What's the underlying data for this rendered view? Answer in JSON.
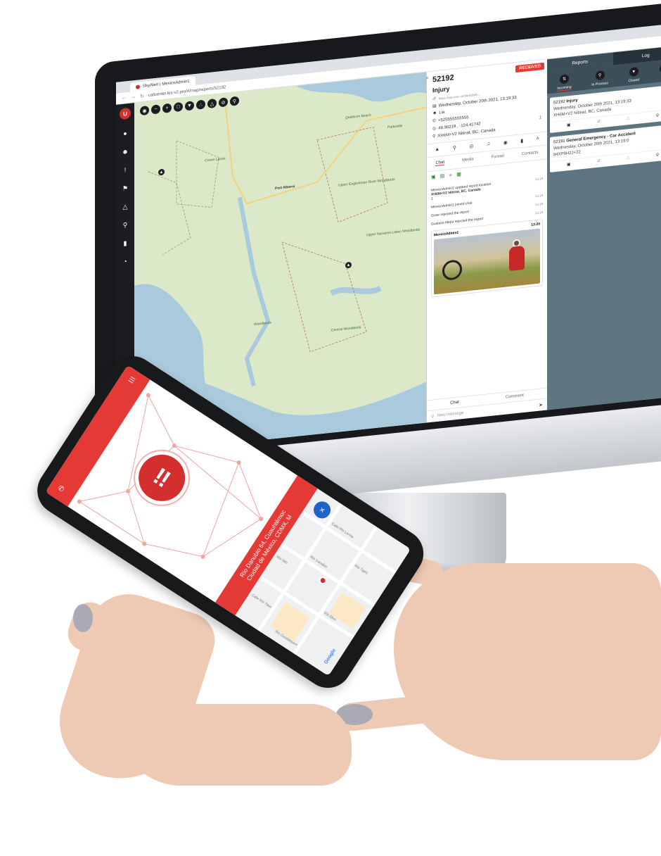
{
  "browser": {
    "tab_title": "SkyAlert | MexicoAdmin1",
    "url": "callcenter.les-v2.pro/#/map/reports/52192"
  },
  "map": {
    "labels": [
      "Port Alberni",
      "Upper Nanaimo Lakes Woodlands",
      "Parksville",
      "Qualicum Beach",
      "Crown Lands",
      "Upper Englishman River Woodlands",
      "Central Woodlands",
      "Woodlands"
    ]
  },
  "report": {
    "status": "RECEIVED",
    "id": "52192",
    "type": "Injury",
    "link": "https://ray-use.com/link/8eb...",
    "date": "Wednesday, October 20th 2021, 13:19:33",
    "user": "Lia",
    "phone": "+525555555555",
    "coordinates": "48.96219 , -124.41742",
    "address": "XH6M+V2 Nitinat, BC, Canada",
    "count_badge": "1",
    "tabs": [
      "Chat",
      "Media",
      "Funnel",
      "Contacts"
    ],
    "chat": [
      {
        "time": "13:19",
        "text": "MexicoAdmin1 updated report location",
        "bold": "XH6M+V2 Nitinat, BC, Canada",
        "badge": "1"
      },
      {
        "time": "13:19",
        "text": "MexicoAdmin1 joined chat"
      },
      {
        "time": "13:19",
        "text": "Gose rejected the report"
      },
      {
        "time": "13:19",
        "text": "Gustavo Mejía rejected the report"
      }
    ],
    "photo_author": "MexicoAdmin1",
    "photo_time": "13:20",
    "bottom_tabs": [
      "Chat",
      "Comment"
    ],
    "message_placeholder": "New message"
  },
  "panel": {
    "tabs": [
      "Reports",
      "Log"
    ],
    "filters": [
      "Incoming",
      "In Process",
      "Closed"
    ],
    "cards": [
      {
        "id": "52192",
        "type": "Injury",
        "date": "Wednesday, October 20th 2021, 13:19:33",
        "location": "XH6M+V2 Nitinat, BC, Canada"
      },
      {
        "id": "52191",
        "type": "General Emergency - Car Accident",
        "date": "Wednesday, October 20th 2021, 13:19:0",
        "location": "84XP8H2J+22"
      }
    ]
  },
  "phone": {
    "address_line1": "Río Danubio 64, Cuauhtémoc",
    "address_line2": "Ciudad de México, CDMX, M",
    "streets": [
      "Calle Río Lerma",
      "Río Tigris",
      "Río Danubio",
      "Río Nilo",
      "Río Ebro",
      "Calle Río Tiber",
      "Río Guadalquivir"
    ],
    "map_brand": "Google",
    "fab_icon": "×"
  },
  "colors": {
    "brand_red": "#e53935",
    "panel_gray": "#5e7480",
    "map_green": "#dbe9c9",
    "water_blue": "#a9c9dd"
  }
}
